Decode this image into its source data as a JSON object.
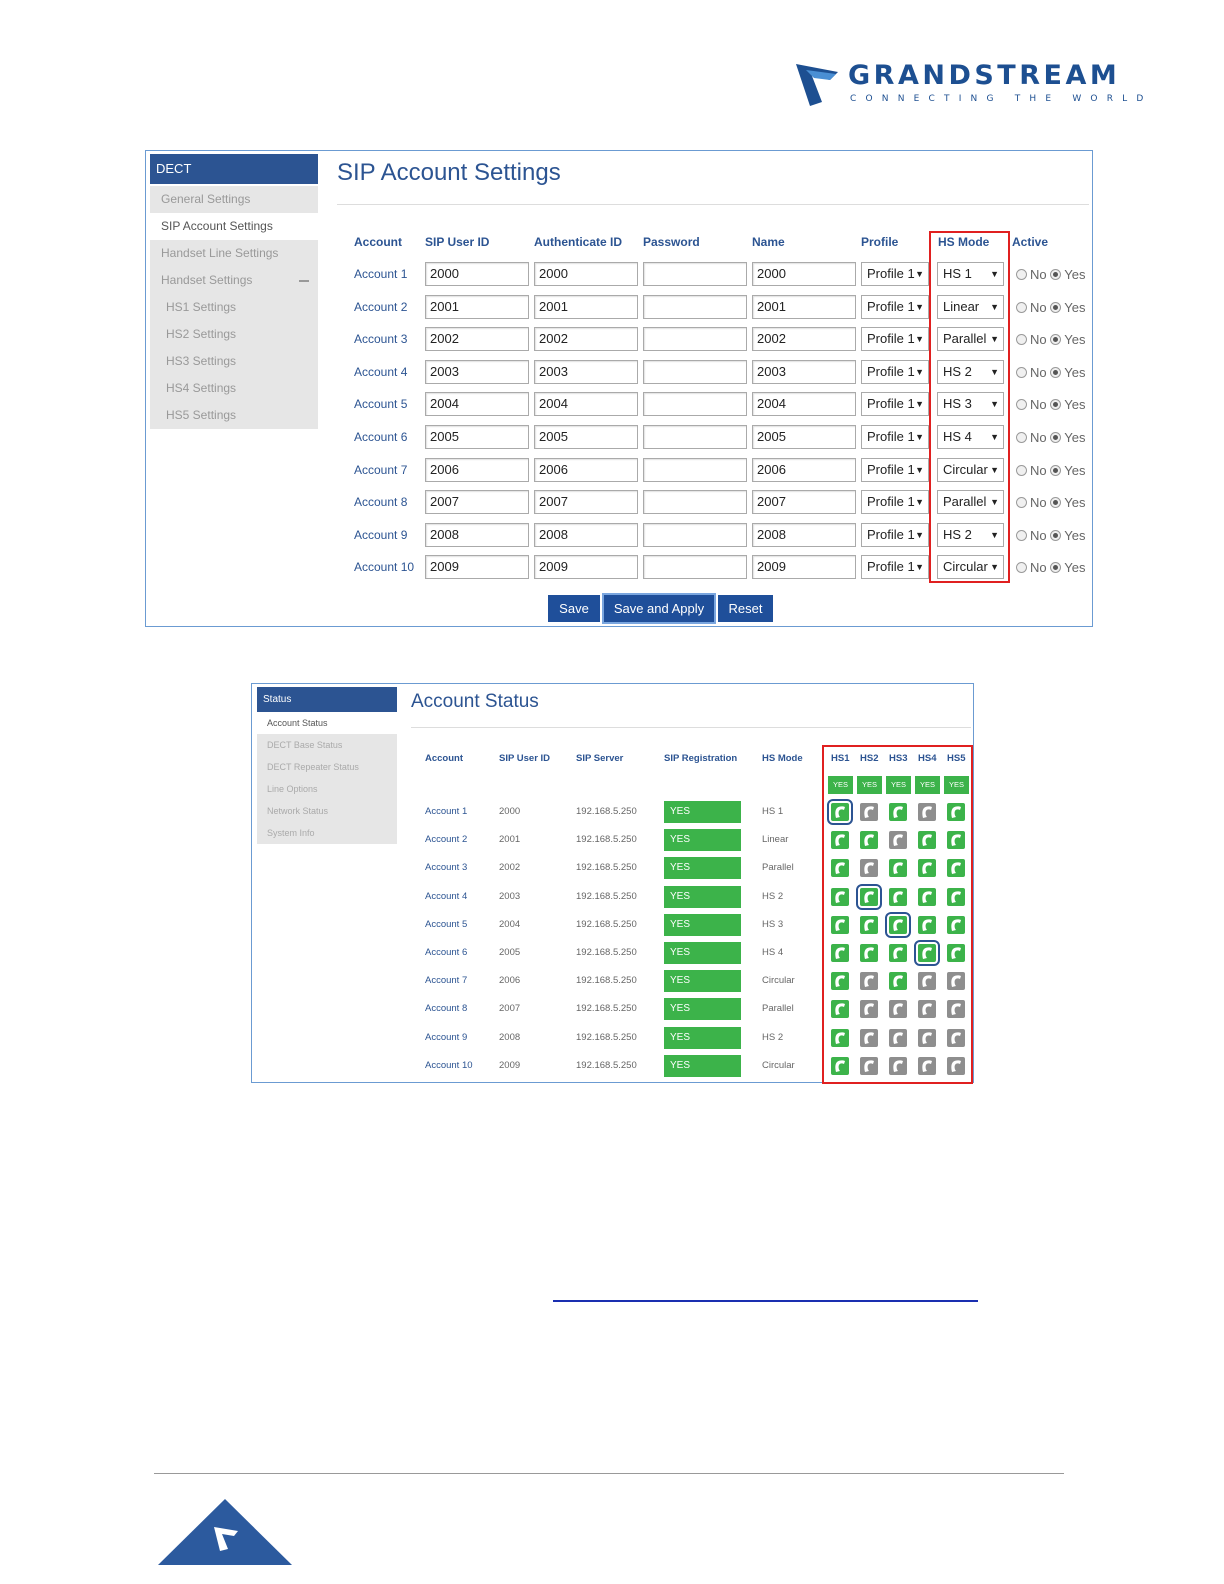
{
  "brand": {
    "name": "GRANDSTREAM",
    "tagline": "CONNECTING THE WORLD"
  },
  "sip_panel": {
    "sidebar": {
      "header": "DECT",
      "items": [
        {
          "label": "General Settings"
        },
        {
          "label": "SIP Account Settings"
        },
        {
          "label": "Handset Line Settings"
        },
        {
          "label": "Handset Settings"
        },
        {
          "label": "HS1 Settings"
        },
        {
          "label": "HS2 Settings"
        },
        {
          "label": "HS3 Settings"
        },
        {
          "label": "HS4 Settings"
        },
        {
          "label": "HS5 Settings"
        }
      ]
    },
    "title": "SIP Account Settings",
    "headers": [
      "Account",
      "SIP User ID",
      "Authenticate ID",
      "Password",
      "Name",
      "Profile",
      "HS Mode",
      "Active"
    ],
    "active_no": "No",
    "active_yes": "Yes",
    "rows": [
      {
        "account": "Account 1",
        "sip_user_id": "2000",
        "auth_id": "2000",
        "password": "",
        "name": "2000",
        "profile": "Profile 1",
        "hs_mode": "HS 1"
      },
      {
        "account": "Account 2",
        "sip_user_id": "2001",
        "auth_id": "2001",
        "password": "",
        "name": "2001",
        "profile": "Profile 1",
        "hs_mode": "Linear"
      },
      {
        "account": "Account 3",
        "sip_user_id": "2002",
        "auth_id": "2002",
        "password": "",
        "name": "2002",
        "profile": "Profile 1",
        "hs_mode": "Parallel"
      },
      {
        "account": "Account 4",
        "sip_user_id": "2003",
        "auth_id": "2003",
        "password": "",
        "name": "2003",
        "profile": "Profile 1",
        "hs_mode": "HS 2"
      },
      {
        "account": "Account 5",
        "sip_user_id": "2004",
        "auth_id": "2004",
        "password": "",
        "name": "2004",
        "profile": "Profile 1",
        "hs_mode": "HS 3"
      },
      {
        "account": "Account 6",
        "sip_user_id": "2005",
        "auth_id": "2005",
        "password": "",
        "name": "2005",
        "profile": "Profile 1",
        "hs_mode": "HS 4"
      },
      {
        "account": "Account 7",
        "sip_user_id": "2006",
        "auth_id": "2006",
        "password": "",
        "name": "2006",
        "profile": "Profile 1",
        "hs_mode": "Circular"
      },
      {
        "account": "Account 8",
        "sip_user_id": "2007",
        "auth_id": "2007",
        "password": "",
        "name": "2007",
        "profile": "Profile 1",
        "hs_mode": "Parallel"
      },
      {
        "account": "Account 9",
        "sip_user_id": "2008",
        "auth_id": "2008",
        "password": "",
        "name": "2008",
        "profile": "Profile 1",
        "hs_mode": "HS 2"
      },
      {
        "account": "Account 10",
        "sip_user_id": "2009",
        "auth_id": "2009",
        "password": "",
        "name": "2009",
        "profile": "Profile 1",
        "hs_mode": "Circular"
      }
    ],
    "buttons": {
      "save": "Save",
      "save_apply": "Save and Apply",
      "reset": "Reset"
    }
  },
  "status_panel": {
    "sidebar": {
      "header": "Status",
      "items": [
        {
          "label": "Account Status"
        },
        {
          "label": "DECT Base Status"
        },
        {
          "label": "DECT Repeater Status"
        },
        {
          "label": "Line Options"
        },
        {
          "label": "Network Status"
        },
        {
          "label": "System Info"
        }
      ]
    },
    "title": "Account Status",
    "headers": [
      "Account",
      "SIP User ID",
      "SIP Server",
      "SIP Registration",
      "HS Mode"
    ],
    "hs_headers": [
      "HS1",
      "HS2",
      "HS3",
      "HS4",
      "HS5"
    ],
    "hs_registered": [
      "YES",
      "YES",
      "YES",
      "YES",
      "YES"
    ],
    "rows": [
      {
        "account": "Account 1",
        "sip_user_id": "2000",
        "sip_server": "192.168.5.250",
        "registration": "YES",
        "hs_mode": "HS 1",
        "hs": [
          "sel",
          "off",
          "on",
          "off",
          "on"
        ]
      },
      {
        "account": "Account 2",
        "sip_user_id": "2001",
        "sip_server": "192.168.5.250",
        "registration": "YES",
        "hs_mode": "Linear",
        "hs": [
          "on",
          "on",
          "off",
          "on",
          "on"
        ]
      },
      {
        "account": "Account 3",
        "sip_user_id": "2002",
        "sip_server": "192.168.5.250",
        "registration": "YES",
        "hs_mode": "Parallel",
        "hs": [
          "on",
          "off",
          "on",
          "on",
          "on"
        ]
      },
      {
        "account": "Account 4",
        "sip_user_id": "2003",
        "sip_server": "192.168.5.250",
        "registration": "YES",
        "hs_mode": "HS 2",
        "hs": [
          "on",
          "sel",
          "on",
          "on",
          "on"
        ]
      },
      {
        "account": "Account 5",
        "sip_user_id": "2004",
        "sip_server": "192.168.5.250",
        "registration": "YES",
        "hs_mode": "HS 3",
        "hs": [
          "on",
          "on",
          "sel",
          "on",
          "on"
        ]
      },
      {
        "account": "Account 6",
        "sip_user_id": "2005",
        "sip_server": "192.168.5.250",
        "registration": "YES",
        "hs_mode": "HS 4",
        "hs": [
          "on",
          "on",
          "on",
          "sel",
          "on"
        ]
      },
      {
        "account": "Account 7",
        "sip_user_id": "2006",
        "sip_server": "192.168.5.250",
        "registration": "YES",
        "hs_mode": "Circular",
        "hs": [
          "on",
          "off",
          "on",
          "off",
          "off"
        ]
      },
      {
        "account": "Account 8",
        "sip_user_id": "2007",
        "sip_server": "192.168.5.250",
        "registration": "YES",
        "hs_mode": "Parallel",
        "hs": [
          "on",
          "off",
          "off",
          "off",
          "off"
        ]
      },
      {
        "account": "Account 9",
        "sip_user_id": "2008",
        "sip_server": "192.168.5.250",
        "registration": "YES",
        "hs_mode": "HS 2",
        "hs": [
          "on",
          "off",
          "off",
          "off",
          "off"
        ]
      },
      {
        "account": "Account 10",
        "sip_user_id": "2009",
        "sip_server": "192.168.5.250",
        "registration": "YES",
        "hs_mode": "Circular",
        "hs": [
          "on",
          "off",
          "off",
          "off",
          "off"
        ]
      }
    ]
  },
  "colors": {
    "brand_blue": "#2c5492",
    "button_blue": "#1f4f9a",
    "status_green": "#3cb34a",
    "inactive_gray": "#8e8e8e",
    "highlight_red": "#e02020"
  }
}
